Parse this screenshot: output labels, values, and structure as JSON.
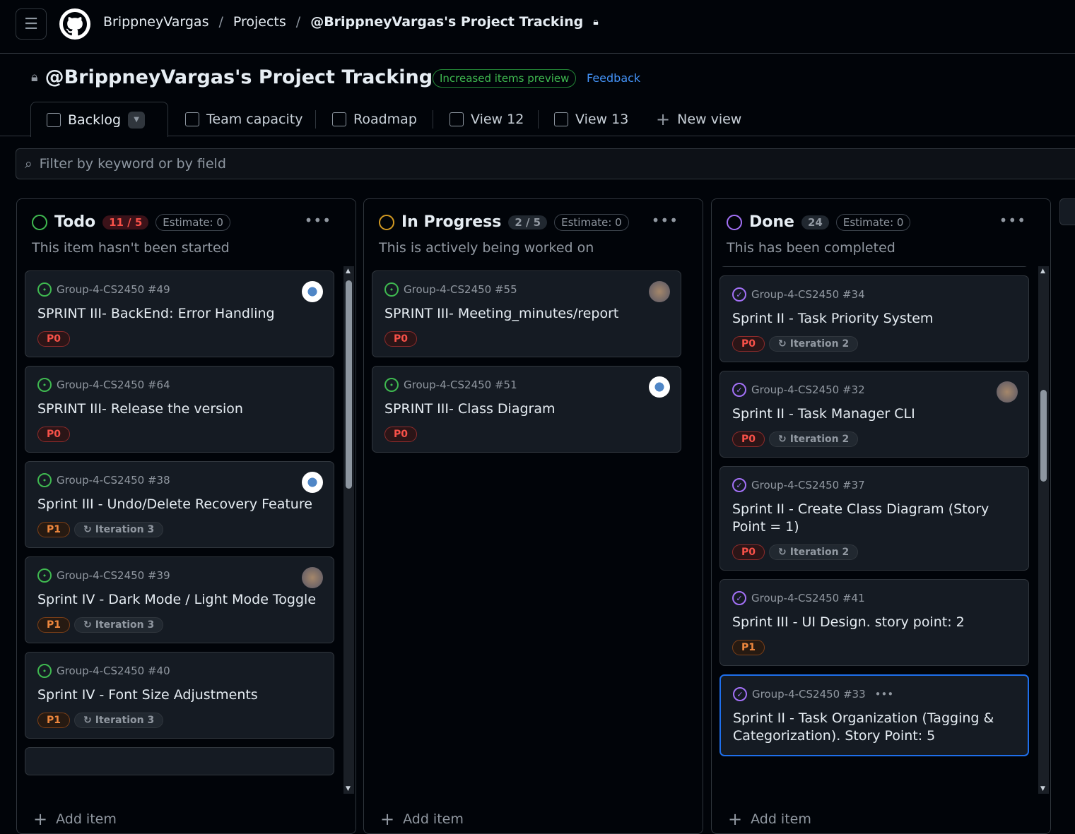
{
  "breadcrumb": {
    "owner": "BrippneyVargas",
    "projects": "Projects",
    "project": "@BrippneyVargas's Project Tracking"
  },
  "title": "@BrippneyVargas's Project Tracking",
  "preview_badge": "Increased items preview",
  "feedback": "Feedback",
  "tabs": [
    "Backlog",
    "Team capacity",
    "Roadmap",
    "View 12",
    "View 13"
  ],
  "new_view": "New view",
  "filter_placeholder": "Filter by keyword or by field",
  "add_item": "Add item",
  "columns": [
    {
      "name": "Todo",
      "count": "11 / 5",
      "estimate": "Estimate: 0",
      "desc": "This item hasn't been started",
      "color": "#3fb950",
      "cards": [
        {
          "ref": "Group-4-CS2450 #49",
          "title": "SPRINT III- BackEnd: Error Handling",
          "priority": "P0"
        },
        {
          "ref": "Group-4-CS2450 #64",
          "title": "SPRINT III- Release the version",
          "priority": "P0"
        },
        {
          "ref": "Group-4-CS2450 #38",
          "title": "Sprint III - Undo/Delete Recovery Feature",
          "priority": "P1",
          "iteration": "Iteration 3"
        },
        {
          "ref": "Group-4-CS2450 #39",
          "title": "Sprint IV - Dark Mode / Light Mode Toggle",
          "priority": "P1",
          "iteration": "Iteration 3"
        },
        {
          "ref": "Group-4-CS2450 #40",
          "title": "Sprint IV - Font Size Adjustments",
          "priority": "P1",
          "iteration": "Iteration 3"
        }
      ]
    },
    {
      "name": "In Progress",
      "count": "2 / 5",
      "estimate": "Estimate: 0",
      "desc": "This is actively being worked on",
      "color": "#d29922",
      "cards": [
        {
          "ref": "Group-4-CS2450 #55",
          "title": "SPRINT III- Meeting_minutes/report",
          "priority": "P0"
        },
        {
          "ref": "Group-4-CS2450 #51",
          "title": "SPRINT III- Class Diagram",
          "priority": "P0"
        }
      ]
    },
    {
      "name": "Done",
      "count": "24",
      "estimate": "Estimate: 0",
      "desc": "This has been completed",
      "color": "#a371f7",
      "cards": [
        {
          "ref": "Group-4-CS2450 #34",
          "title": "Sprint II - Task Priority System",
          "priority": "P0",
          "iteration": "Iteration 2"
        },
        {
          "ref": "Group-4-CS2450 #32",
          "title": "Sprint II - Task Manager CLI",
          "priority": "P0",
          "iteration": "Iteration 2"
        },
        {
          "ref": "Group-4-CS2450 #37",
          "title": "Sprint II - Create Class Diagram (Story Point = 1)",
          "priority": "P0",
          "iteration": "Iteration 2"
        },
        {
          "ref": "Group-4-CS2450 #41",
          "title": "Sprint III - UI Design. story point: 2",
          "priority": "P1"
        },
        {
          "ref": "Group-4-CS2450 #33",
          "title": "Sprint II - Task Organization (Tagging & Categorization). Story Point: 5"
        }
      ]
    }
  ]
}
